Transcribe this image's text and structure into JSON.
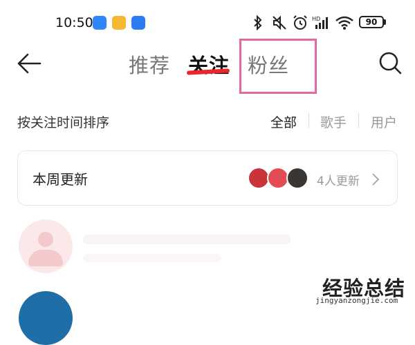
{
  "status_bar": {
    "time": "10:50",
    "battery": "90"
  },
  "nav": {
    "tabs": [
      {
        "label": "推荐",
        "active": false
      },
      {
        "label": "关注",
        "active": true
      },
      {
        "label": "粉丝",
        "active": false
      }
    ],
    "accent_color": "#e8262b",
    "highlight_color": "#e36aa0"
  },
  "sort": {
    "label": "按关注时间排序",
    "filters": [
      {
        "label": "全部",
        "active": true
      },
      {
        "label": "歌手",
        "active": false
      },
      {
        "label": "用户",
        "active": false
      }
    ]
  },
  "weekly_update": {
    "title": "本周更新",
    "count_text": "4人更新"
  },
  "watermark": {
    "logo": "经验总结",
    "url": "jingyanzongjie.com"
  }
}
